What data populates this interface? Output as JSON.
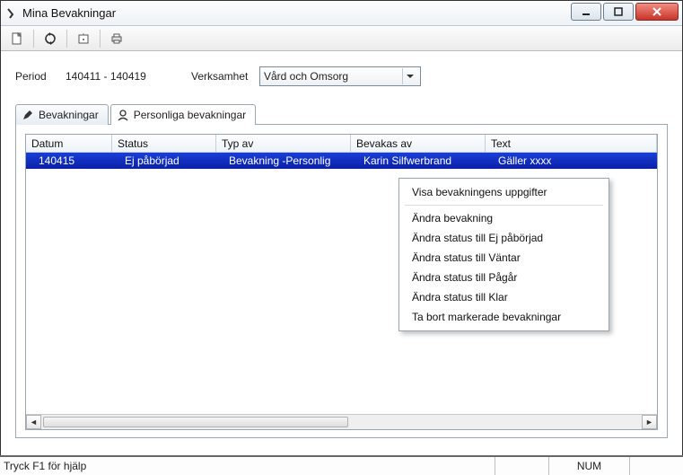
{
  "window": {
    "title": "Mina Bevakningar"
  },
  "filters": {
    "period_label": "Period",
    "period_value": "140411 - 140419",
    "verksamhet_label": "Verksamhet",
    "verksamhet_value": "Vård och Omsorg"
  },
  "tabs": {
    "bevakningar": "Bevakningar",
    "personliga": "Personliga bevakningar"
  },
  "table": {
    "headers": {
      "datum": "Datum",
      "status": "Status",
      "typ": "Typ av",
      "bevakas": "Bevakas av",
      "text": "Text"
    },
    "rows": [
      {
        "datum": "140415",
        "status": "Ej påbörjad",
        "typ": "Bevakning -Personlig",
        "bevakas": "Karin Silfwerbrand",
        "text": "Gäller xxxx"
      }
    ]
  },
  "context_menu": {
    "items": [
      "Visa bevakningens uppgifter",
      "Ändra bevakning",
      "Ändra status till Ej påbörjad",
      "Ändra status till Väntar",
      "Ändra status till Pågår",
      "Ändra status till Klar",
      "Ta bort markerade bevakningar"
    ]
  },
  "statusbar": {
    "help": "Tryck F1 för hjälp",
    "num": "NUM"
  }
}
